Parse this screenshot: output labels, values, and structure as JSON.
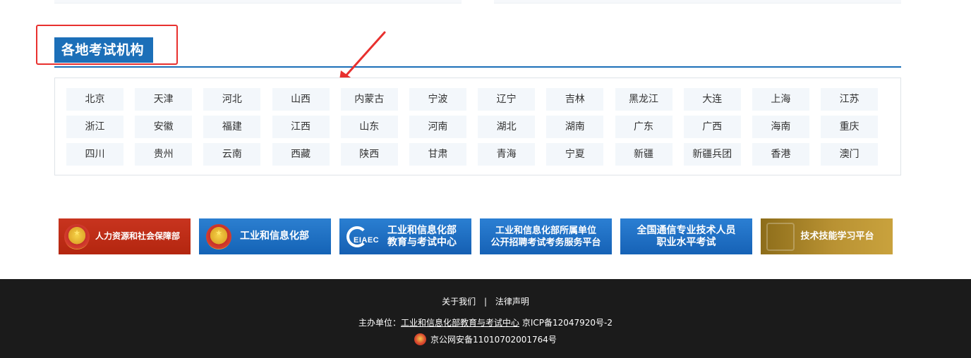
{
  "section": {
    "title": "各地考试机构"
  },
  "regions": [
    "北京",
    "天津",
    "河北",
    "山西",
    "内蒙古",
    "宁波",
    "辽宁",
    "吉林",
    "黑龙江",
    "大连",
    "上海",
    "江苏",
    "浙江",
    "安徽",
    "福建",
    "江西",
    "山东",
    "河南",
    "湖北",
    "湖南",
    "广东",
    "广西",
    "海南",
    "重庆",
    "四川",
    "贵州",
    "云南",
    "西藏",
    "陕西",
    "甘肃",
    "青海",
    "宁夏",
    "新疆",
    "新疆兵团",
    "香港",
    "澳门"
  ],
  "banners": {
    "mohrss": "人力资源和社会保障部",
    "miit": "工业和信息化部",
    "ceiaec_line1": "工业和信息化部",
    "ceiaec_line2": "教育与考试中心",
    "ceiaec_logo": "EIAEC",
    "affiliated_line1": "工业和信息化部所属单位",
    "affiliated_line2": "公开招聘考试考务服务平台",
    "telecom_line1": "全国通信专业技术人员",
    "telecom_line2": "职业水平考试",
    "skills": "技术技能学习平台"
  },
  "footer": {
    "about": "关于我们",
    "separator": "|",
    "legal": "法律声明",
    "host_prefix": "主办单位：",
    "host_name": "工业和信息化部教育与考试中心",
    "icp": "京ICP备12047920号-2",
    "police": "京公网安备11010702001764号"
  },
  "colors": {
    "accent_blue": "#1c6fb8",
    "highlight_red": "#e8302e",
    "footer_bg": "#1b1b1b"
  }
}
